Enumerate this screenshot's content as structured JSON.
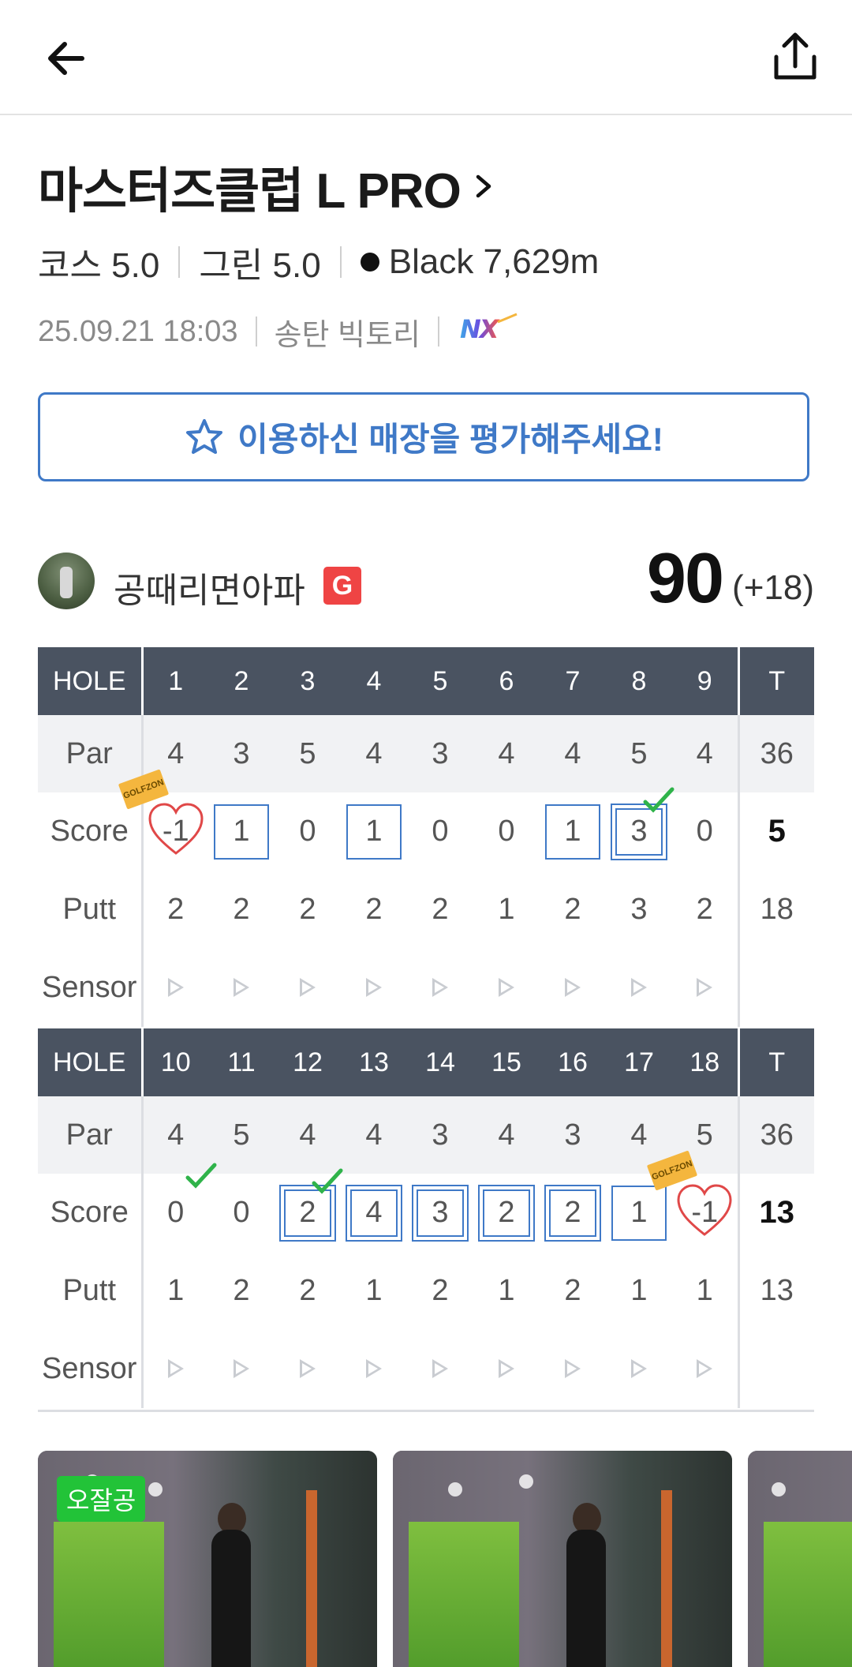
{
  "header": {
    "back_icon": "arrow-left-icon",
    "share_icon": "share-icon"
  },
  "course": {
    "title": "마스터즈클럽 L PRO",
    "course_rating": "코스 5.0",
    "green_rating": "그린 5.0",
    "tee": "Black 7,629m",
    "datetime": "25.09.21 18:03",
    "store": "송탄 빅토리",
    "system_logo": "NX"
  },
  "review_button": {
    "label": "이용하신 매장을 평가해주세요!",
    "icon": "star-outline-icon",
    "color": "#3f79c7"
  },
  "player": {
    "name": "공때리면아파",
    "grade": "G",
    "total": "90",
    "diff": "(+18)"
  },
  "scorecard": {
    "labels": {
      "hole": "HOLE",
      "par": "Par",
      "score": "Score",
      "putt": "Putt",
      "sensor": "Sensor",
      "total": "T"
    },
    "front": {
      "holes": [
        "1",
        "2",
        "3",
        "4",
        "5",
        "6",
        "7",
        "8",
        "9"
      ],
      "par": [
        "4",
        "3",
        "5",
        "4",
        "3",
        "4",
        "4",
        "5",
        "4"
      ],
      "par_total": "36",
      "score": [
        "-1",
        "1",
        "0",
        "1",
        "0",
        "0",
        "1",
        "3",
        "0"
      ],
      "score_marks": [
        "heart",
        "box",
        "",
        "box",
        "",
        "",
        "box",
        "dbox",
        ""
      ],
      "golfzon_badge": [
        true,
        false,
        false,
        false,
        false,
        false,
        false,
        false,
        false
      ],
      "check": [
        false,
        false,
        false,
        false,
        false,
        false,
        false,
        true,
        false
      ],
      "score_total": "5",
      "putt": [
        "2",
        "2",
        "2",
        "2",
        "2",
        "1",
        "2",
        "3",
        "2"
      ],
      "putt_total": "18"
    },
    "back": {
      "holes": [
        "10",
        "11",
        "12",
        "13",
        "14",
        "15",
        "16",
        "17",
        "18"
      ],
      "par": [
        "4",
        "5",
        "4",
        "4",
        "3",
        "4",
        "3",
        "4",
        "5"
      ],
      "par_total": "36",
      "score": [
        "0",
        "0",
        "2",
        "4",
        "3",
        "2",
        "2",
        "1",
        "-1"
      ],
      "score_marks": [
        "",
        "",
        "dbox",
        "dbox",
        "dbox",
        "dbox",
        "dbox",
        "box",
        "heart"
      ],
      "golfzon_badge": [
        false,
        false,
        false,
        false,
        false,
        false,
        false,
        false,
        true
      ],
      "check": [
        true,
        false,
        true,
        false,
        false,
        false,
        false,
        false,
        false
      ],
      "score_total": "13",
      "putt": [
        "1",
        "2",
        "2",
        "1",
        "2",
        "1",
        "2",
        "1",
        "1"
      ],
      "putt_total": "13"
    },
    "golfzon_badge_text": "GOLFZON",
    "colors": {
      "header_bg": "#4a5361",
      "par_bg": "#f1f2f4",
      "box": "#3f79c7",
      "heart": "#e04848",
      "check": "#2fb34a"
    }
  },
  "media": {
    "badge": "오잘공",
    "thumbnails": [
      "swing-video-1",
      "swing-video-2",
      "swing-video-3"
    ]
  }
}
